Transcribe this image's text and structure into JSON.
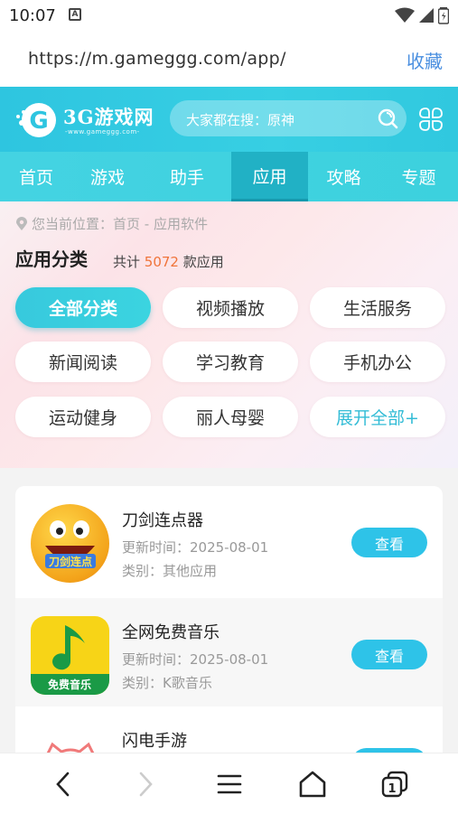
{
  "status": {
    "time": "10:07",
    "notif": "A"
  },
  "browser": {
    "url": "https://m.gameggg.com/app/",
    "favorite_label": "收藏"
  },
  "header": {
    "brand": "3G游戏网",
    "site_url": "-www.gameggg.com-",
    "search_hint": "大家都在搜：原神"
  },
  "nav": {
    "tabs": [
      {
        "label": "首页",
        "active": false
      },
      {
        "label": "游戏",
        "active": false
      },
      {
        "label": "助手",
        "active": false
      },
      {
        "label": "应用",
        "active": true
      },
      {
        "label": "攻略",
        "active": false
      },
      {
        "label": "专题",
        "active": false
      }
    ]
  },
  "category": {
    "breadcrumb": "您当前位置：首页 - 应用软件",
    "title": "应用分类",
    "count_prefix": "共计",
    "count": "5072",
    "count_suffix": "款应用",
    "chips": [
      {
        "label": "全部分类",
        "active": true
      },
      {
        "label": "视频播放"
      },
      {
        "label": "生活服务"
      },
      {
        "label": "新闻阅读"
      },
      {
        "label": "学习教育"
      },
      {
        "label": "手机办公"
      },
      {
        "label": "运动健身"
      },
      {
        "label": "丽人母婴"
      },
      {
        "label": "展开全部+",
        "more": true
      }
    ]
  },
  "apps": [
    {
      "name": "刀剑连点器",
      "updated": "更新时间：2025-08-01",
      "category": "类别：其他应用",
      "button": "查看",
      "icon_text": "刀剑连点"
    },
    {
      "name": "全网免费音乐",
      "updated": "更新时间：2025-08-01",
      "category": "类别：K歌音乐",
      "button": "查看",
      "icon_text": "免费音乐"
    },
    {
      "name": "闪电手游",
      "updated": "",
      "category": "",
      "button": "",
      "icon_text": ""
    }
  ],
  "colors": {
    "accent": "#2ec5e0",
    "count": "#f0743a",
    "button": "#2ec3e8"
  }
}
